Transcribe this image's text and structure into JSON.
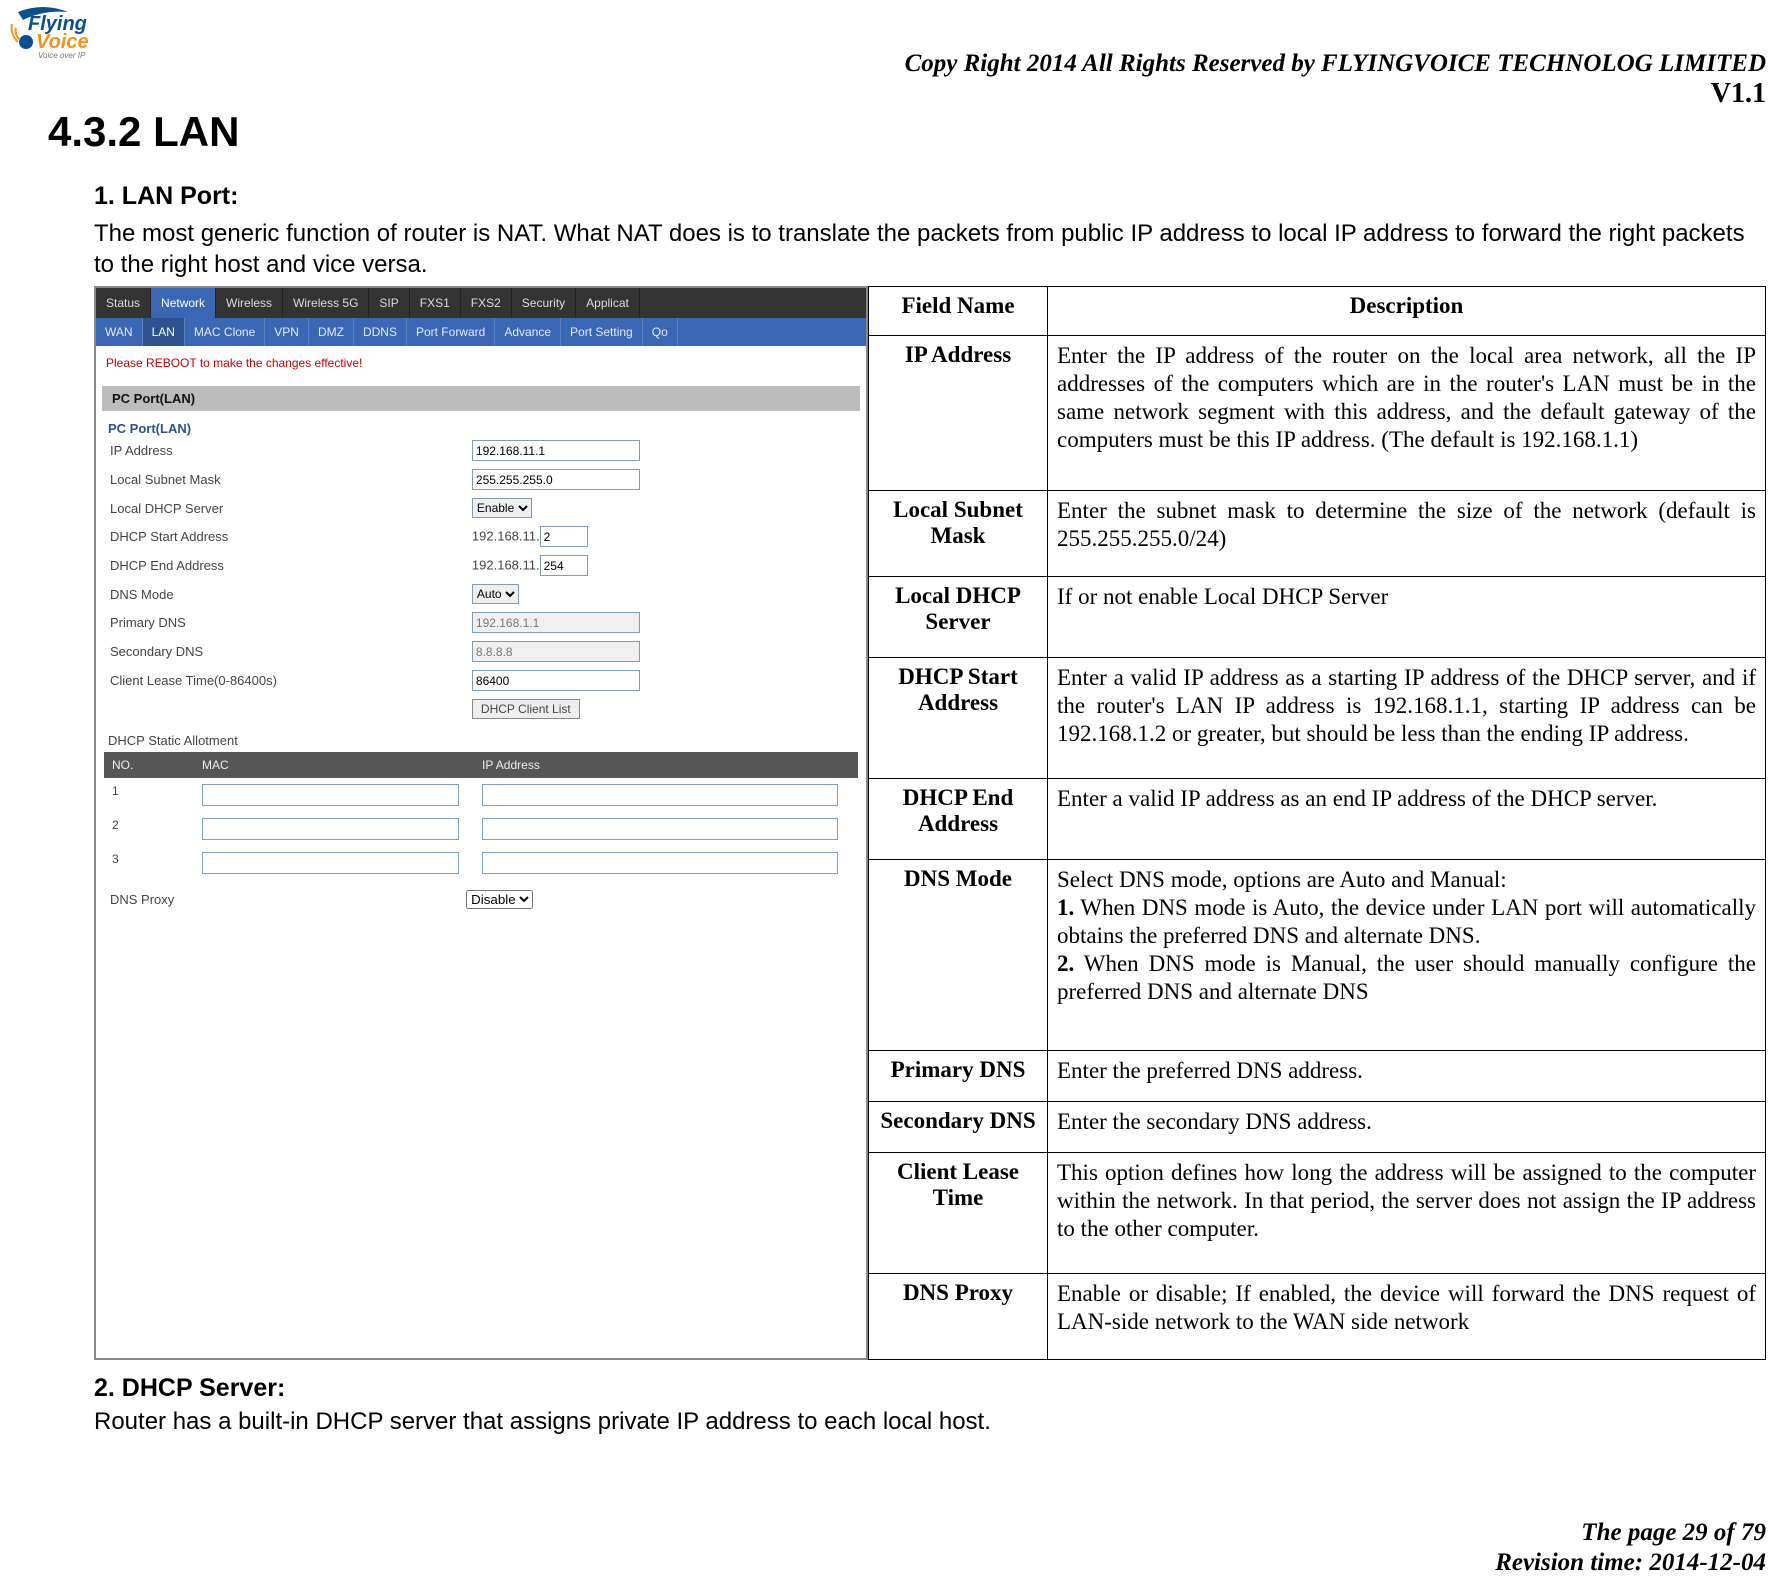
{
  "logo": {
    "line1": "Flying",
    "line2": "Voice",
    "tag": "Voice over IP"
  },
  "header": {
    "copyright": "Copy Right 2014 All Rights Reserved by FLYINGVOICE TECHNOLOG LIMITED",
    "version": "V1.1"
  },
  "section_title": "4.3.2 LAN",
  "sub1": {
    "heading": "1.  LAN Port:",
    "text": "The most generic function of router is NAT. What NAT does is to translate the packets from public IP address to local IP address to forward the right packets to the right host and vice versa."
  },
  "screenshot": {
    "tabs1": [
      "Status",
      "Network",
      "Wireless",
      "Wireless 5G",
      "SIP",
      "FXS1",
      "FXS2",
      "Security",
      "Applicat"
    ],
    "tabs1_active": "Network",
    "tabs2": [
      "WAN",
      "LAN",
      "MAC Clone",
      "VPN",
      "DMZ",
      "DDNS",
      "Port Forward",
      "Advance",
      "Port Setting",
      "Qo"
    ],
    "tabs2_active": "LAN",
    "reboot_msg": "Please REBOOT to make the changes effective!",
    "pane_title": "PC Port(LAN)",
    "legend": "PC Port(LAN)",
    "fields": {
      "ip_addr": {
        "label": "IP Address",
        "value": "192.168.11.1"
      },
      "subnet": {
        "label": "Local Subnet Mask",
        "value": "255.255.255.0"
      },
      "dhcp_srv": {
        "label": "Local DHCP Server",
        "value": "Enable"
      },
      "dhcp_start": {
        "label": "DHCP Start Address",
        "prefix": "192.168.11.",
        "value": "2"
      },
      "dhcp_end": {
        "label": "DHCP End Address",
        "prefix": "192.168.11.",
        "value": "254"
      },
      "dns_mode": {
        "label": "DNS Mode",
        "value": "Auto"
      },
      "primary": {
        "label": "Primary DNS",
        "value": "192.168.1.1"
      },
      "secondary": {
        "label": "Secondary DNS",
        "value": "8.8.8.8"
      },
      "lease": {
        "label": "Client Lease Time(0-86400s)",
        "value": "86400"
      },
      "dhcp_list_btn": "DHCP Client List",
      "allot_title": "DHCP Static Allotment",
      "col_no": "NO.",
      "col_mac": "MAC",
      "col_ip": "IP Address",
      "rows": [
        "1",
        "2",
        "3"
      ],
      "dns_proxy": {
        "label": "DNS Proxy",
        "value": "Disable"
      }
    }
  },
  "desc_headers": {
    "field": "Field Name",
    "desc": "Description"
  },
  "desc_rows": [
    {
      "name": "IP Address",
      "desc": "Enter the IP address of the router on the local area network, all the IP addresses of the computers which are in the router's LAN must be in the same network segment with this address, and the default gateway of the computers must be this IP address. (The default is 192.168.1.1)"
    },
    {
      "name": "Local Subnet Mask",
      "desc": "Enter the subnet mask to determine the size of the network (default is 255.255.255.0/24)"
    },
    {
      "name": "Local DHCP Server",
      "desc": "If or not enable Local DHCP Server"
    },
    {
      "name": "DHCP Start Address",
      "desc": "Enter a valid IP address as a starting IP address of the DHCP server, and if the router's LAN IP address is 192.168.1.1, starting IP address can be 192.168.1.2 or greater, but should be less than the ending IP address."
    },
    {
      "name": "DHCP End Address",
      "desc": "Enter a valid IP address as an end IP address of the DHCP server."
    },
    {
      "name": "DNS Mode",
      "desc_intro": "Select DNS mode, options are Auto and Manual:",
      "desc_1": " When DNS mode is Auto, the device under LAN port will automatically obtains the preferred DNS and alternate DNS.",
      "desc_2": " When DNS mode is Manual, the user should manually configure the preferred DNS and alternate DNS"
    },
    {
      "name": "Primary DNS",
      "desc": "Enter the preferred DNS address."
    },
    {
      "name": "Secondary DNS",
      "desc": "Enter the secondary DNS address."
    },
    {
      "name": "Client Lease Time",
      "desc": "This option defines how long the address will be assigned to the computer within the network. In that period, the server does not assign the IP address to the other computer."
    },
    {
      "name": "DNS Proxy",
      "desc": "Enable or disable; If enabled, the device will forward the DNS request of LAN-side network to the WAN side network"
    }
  ],
  "sub2": {
    "heading": "2.  DHCP Server:",
    "text": "Router has a built-in DHCP server that assigns private IP address to each local host."
  },
  "footer": {
    "page": "The page 29 of 79",
    "rev": "Revision time: 2014-12-04"
  }
}
